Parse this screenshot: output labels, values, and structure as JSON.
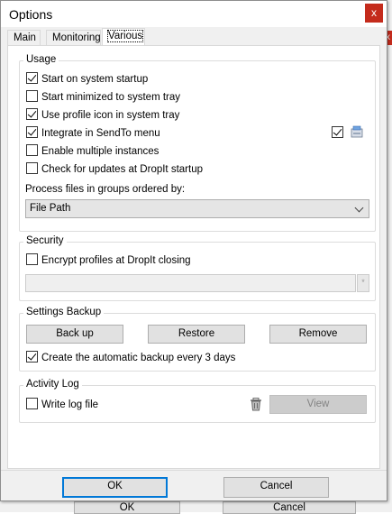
{
  "window": {
    "title": "Options",
    "close_label": "x"
  },
  "background": {
    "close_label": "x",
    "ok_label": "OK",
    "cancel_label": "Cancel"
  },
  "tabs": [
    {
      "label": "Main",
      "active": false
    },
    {
      "label": "Monitoring",
      "active": false
    },
    {
      "label": "Various",
      "active": true
    }
  ],
  "usage": {
    "title": "Usage",
    "options": [
      {
        "label": "Start on system startup",
        "checked": true
      },
      {
        "label": "Start minimized to system tray",
        "checked": false
      },
      {
        "label": "Use profile icon in system tray",
        "checked": true
      },
      {
        "label": "Integrate in SendTo menu",
        "checked": true
      },
      {
        "label": "Enable multiple instances",
        "checked": false
      },
      {
        "label": "Check for updates at DropIt startup",
        "checked": false
      }
    ],
    "sendto_icon_checked": true,
    "sendto_icon": "drive-icon",
    "group_label": "Process files in groups ordered by:",
    "group_value": "File Path"
  },
  "security": {
    "title": "Security",
    "encrypt_label": "Encrypt profiles at DropIt closing",
    "encrypt_checked": false,
    "password_value": "",
    "combo_button": "*"
  },
  "backup": {
    "title": "Settings Backup",
    "backup_label": "Back up",
    "restore_label": "Restore",
    "remove_label": "Remove",
    "auto_label": "Create the automatic backup every 3 days",
    "auto_checked": true
  },
  "log": {
    "title": "Activity Log",
    "write_label": "Write log file",
    "write_checked": false,
    "trash_icon": "trash-icon",
    "view_label": "View"
  },
  "footer": {
    "ok_label": "OK",
    "cancel_label": "Cancel"
  }
}
